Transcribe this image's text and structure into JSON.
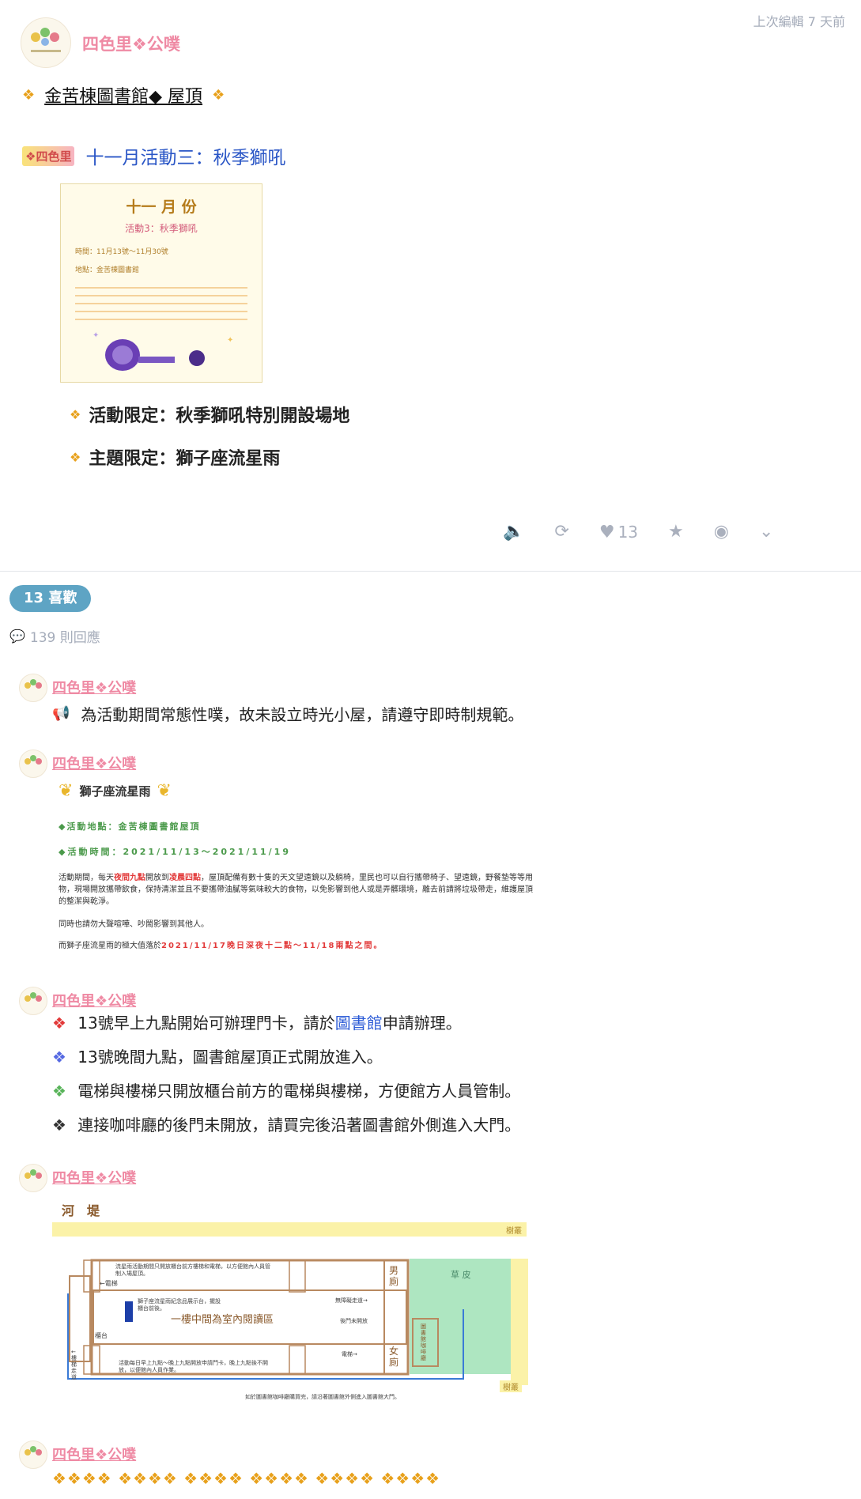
{
  "post": {
    "author": "四色里❖公噗",
    "edited": "上次編輯 7 天前",
    "title_line": "金苦棟圖書館◆ 屋頂",
    "logo_text": "❖四色里",
    "event_title": "十一月活動三：秋季獅吼",
    "poster": {
      "month": "十一 月 份",
      "activity": "活動3：秋季獅吼",
      "time": "時間：11月13號～11月30號",
      "place": "地點：金苦棟圖書館"
    },
    "bullets": [
      "活動限定：秋季獅吼特別開設場地",
      "主題限定：獅子座流星雨"
    ],
    "like_count": "13"
  },
  "stats": {
    "likes_badge": "13 喜歡",
    "replies": "139 則回應"
  },
  "replies": [
    {
      "author": "四色里❖公噗",
      "text": "為活動期間常態性噗，故未設立時光小屋，請遵守即時制規範。"
    },
    {
      "author": "四色里❖公噗",
      "card": {
        "title": "獅子座流星雨",
        "place": "◆活動地點：金苦棟圖書館屋頂",
        "time": "◆活動時間：2021/11/13～2021/11/19",
        "p1_a": "活動期間，每天",
        "p1_b": "夜間九點",
        "p1_c": "開放到",
        "p1_d": "凌晨四點",
        "p1_e": "，屋頂配備有數十隻的天文望遠鏡以及躺椅，里民也可以自行攜帶椅子、望遠鏡，野餐墊等等用物，現場開放攜帶飲食，保持清潔並且不要攜帶油膩等氣味較大的食物，以免影響到他人或是弄髒環境，離去前請將垃圾帶走，維護屋頂的整潔與乾淨。",
        "p2": "同時也請勿大聲喧嘩、吵鬧影響到其他人。",
        "p3_a": "而獅子座流星雨的極大值落於",
        "p3_b": "2021/11/17晚日深夜十二點～11/18兩點之間。"
      }
    },
    {
      "author": "四色里❖公噗",
      "lines": [
        {
          "pre": "13號早上九點開始可辦理門卡，請於",
          "link": "圖書館",
          "post": "申請辦理。"
        },
        {
          "pre": "13號晚間九點，圖書館屋頂正式開放進入。"
        },
        {
          "pre": "電梯與樓梯只開放櫃台前方的電梯與樓梯，方便館方人員管制。"
        },
        {
          "pre": "連接咖啡廳的後門未開放，請買完後沿著圖書館外側進入大門。"
        }
      ]
    },
    {
      "author": "四色里❖公噗",
      "map": {
        "river": "河　堤",
        "tree_top": "樹叢",
        "tree_bottom": "樹叢",
        "lawn": "草 皮",
        "men": "男廁",
        "women": "女廁",
        "reading": "一樓中間為室內閱讀區",
        "note_top": "流星雨活動期間只開放櫃台前方樓梯和電梯，以方便館內人員管制入場屋頂。",
        "elevator1": "←電梯",
        "statue": "獅子座流星雨紀念品展示台，擺設櫃台前後。",
        "counter": "櫃台",
        "stairs": "←樓梯走道",
        "note_bottom": "活動每日早上九點～晚上九點開放申請門卡，晚上九點後不開放，以便館內人員作業。",
        "barrier": "無障礙走道→",
        "backdoor": "後門未開放",
        "cafe": "圖書館咖啡廳",
        "elevator2": "電梯→",
        "bottom_note": "如於圖書館咖啡廳購買完，請沿著圖書館外側進入圖書館大門。"
      }
    },
    {
      "author": "四色里❖公噗",
      "diamonds": "❖❖❖❖ ❖❖❖❖ ❖❖❖❖ ❖❖❖❖ ❖❖❖❖ ❖❖❖❖"
    }
  ]
}
